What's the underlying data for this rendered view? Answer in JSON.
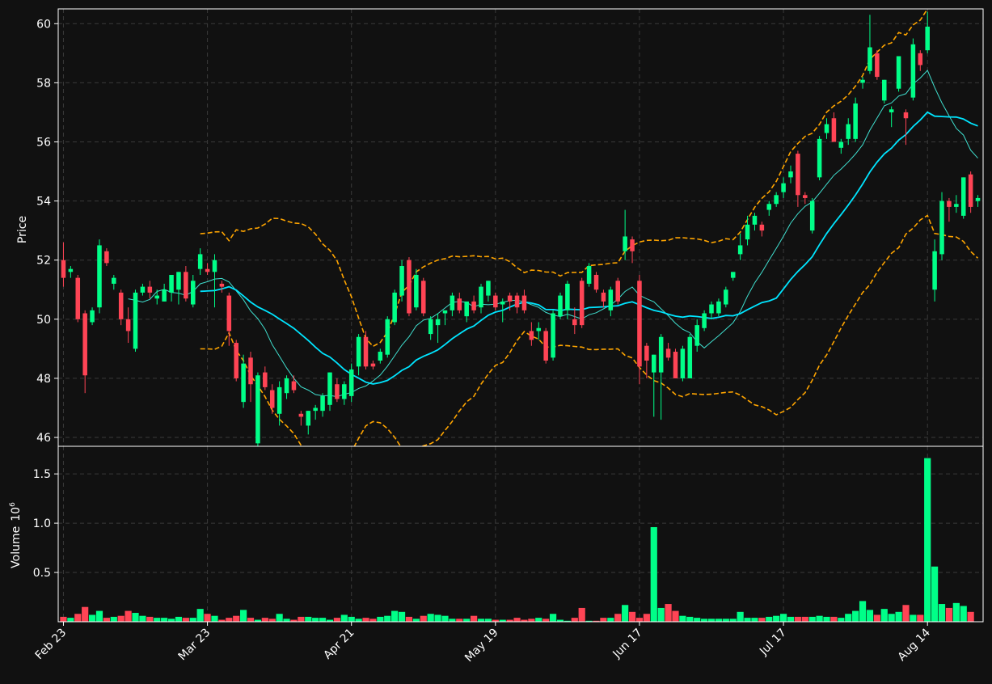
{
  "colors": {
    "background": "#111111",
    "up": "#00ff88",
    "down": "#ff4455",
    "ma_fast": "#40e0d0",
    "ma_slow": "#00e5ff",
    "bands": "#ffa500",
    "grid": "#3a3a3a",
    "axis": "#ffffff"
  },
  "chart_data": {
    "type": "candlestick",
    "price_ylabel": "Price",
    "volume_ylabel": "Volume",
    "volume_multiplier": "10",
    "volume_exponent": "6",
    "price_ylim": [
      45.7,
      60.5
    ],
    "price_ticks": [
      "46",
      "48",
      "50",
      "52",
      "54",
      "56",
      "58",
      "60"
    ],
    "price_tick_values": [
      46,
      48,
      50,
      52,
      54,
      56,
      58,
      60
    ],
    "volume_ylim": [
      0,
      1.78
    ],
    "volume_ticks": [
      "0.5",
      "1.0",
      "1.5"
    ],
    "volume_tick_values": [
      0.5,
      1.0,
      1.5
    ],
    "x_tick_labels": [
      "Feb 23",
      "Mar 23",
      "Apr 21",
      "May 19",
      "Jun 17",
      "Jul 17",
      "Aug 14"
    ],
    "x_tick_index": [
      0,
      20,
      40,
      60,
      80,
      100,
      120
    ],
    "grid": true,
    "candles": [
      [
        52.0,
        52.6,
        51.1,
        51.4
      ],
      [
        51.6,
        51.8,
        51.4,
        51.7
      ],
      [
        51.4,
        51.5,
        49.9,
        50.0
      ],
      [
        50.2,
        50.3,
        47.5,
        48.1
      ],
      [
        49.9,
        50.4,
        49.8,
        50.3
      ],
      [
        50.4,
        52.7,
        50.2,
        52.5
      ],
      [
        52.3,
        52.4,
        51.8,
        51.9
      ],
      [
        51.2,
        51.5,
        51.0,
        51.4
      ],
      [
        50.9,
        51.0,
        49.8,
        50.0
      ],
      [
        50.0,
        50.4,
        49.2,
        49.6
      ],
      [
        49.0,
        51.0,
        48.9,
        50.9
      ],
      [
        50.9,
        51.2,
        50.8,
        51.1
      ],
      [
        51.1,
        51.3,
        50.7,
        50.9
      ],
      [
        50.7,
        51.0,
        50.5,
        50.8
      ],
      [
        50.6,
        51.2,
        50.6,
        51.0
      ],
      [
        50.9,
        51.4,
        50.6,
        51.5
      ],
      [
        51.0,
        51.6,
        50.5,
        51.6
      ],
      [
        51.6,
        51.8,
        50.6,
        50.7
      ],
      [
        50.5,
        51.5,
        50.4,
        51.3
      ],
      [
        51.7,
        52.4,
        51.5,
        52.2
      ],
      [
        51.7,
        51.9,
        51.5,
        51.6
      ],
      [
        51.6,
        52.2,
        50.4,
        52.0
      ],
      [
        51.2,
        51.3,
        50.9,
        51.1
      ],
      [
        50.8,
        50.9,
        49.1,
        49.6
      ],
      [
        49.2,
        49.3,
        47.9,
        48.0
      ],
      [
        47.2,
        48.8,
        47.0,
        48.5
      ],
      [
        48.7,
        48.9,
        47.2,
        47.8
      ],
      [
        45.8,
        48.2,
        45.7,
        48.1
      ],
      [
        48.2,
        48.4,
        47.6,
        47.7
      ],
      [
        47.6,
        47.8,
        46.8,
        47.0
      ],
      [
        46.8,
        47.9,
        46.4,
        47.7
      ],
      [
        47.5,
        48.1,
        47.3,
        48.0
      ],
      [
        47.9,
        48.1,
        47.5,
        47.6
      ],
      [
        46.8,
        46.9,
        46.4,
        46.7
      ],
      [
        46.4,
        46.9,
        46.1,
        46.9
      ],
      [
        46.9,
        47.1,
        46.6,
        47.0
      ],
      [
        46.9,
        47.5,
        46.7,
        47.4
      ],
      [
        47.1,
        48.2,
        46.9,
        48.2
      ],
      [
        47.8,
        48.0,
        47.2,
        47.3
      ],
      [
        47.3,
        47.9,
        47.1,
        47.8
      ],
      [
        47.4,
        48.5,
        47.2,
        48.3
      ],
      [
        48.4,
        49.5,
        48.1,
        49.4
      ],
      [
        49.4,
        49.6,
        48.3,
        48.4
      ],
      [
        48.5,
        48.6,
        48.3,
        48.4
      ],
      [
        48.6,
        49.0,
        48.5,
        48.9
      ],
      [
        48.8,
        50.1,
        48.7,
        50.0
      ],
      [
        49.9,
        51.0,
        49.8,
        50.9
      ],
      [
        50.8,
        52.0,
        50.6,
        51.8
      ],
      [
        52.0,
        52.1,
        50.1,
        50.2
      ],
      [
        50.4,
        51.7,
        50.3,
        51.5
      ],
      [
        51.3,
        51.4,
        50.1,
        50.2
      ],
      [
        49.5,
        50.1,
        49.3,
        50.0
      ],
      [
        49.8,
        50.2,
        49.2,
        50.0
      ],
      [
        50.2,
        50.3,
        49.8,
        50.3
      ],
      [
        50.3,
        50.9,
        50.1,
        50.8
      ],
      [
        50.7,
        50.9,
        50.2,
        50.3
      ],
      [
        50.1,
        50.4,
        49.9,
        50.6
      ],
      [
        50.6,
        50.8,
        50.2,
        50.3
      ],
      [
        50.4,
        51.2,
        50.2,
        51.1
      ],
      [
        50.8,
        51.3,
        50.6,
        51.3
      ],
      [
        50.8,
        50.9,
        50.3,
        50.4
      ],
      [
        50.5,
        50.7,
        49.9,
        50.6
      ],
      [
        50.8,
        50.9,
        50.3,
        50.6
      ],
      [
        50.8,
        50.9,
        50.2,
        50.4
      ],
      [
        50.8,
        51.0,
        50.2,
        50.3
      ],
      [
        49.6,
        49.9,
        49.1,
        49.3
      ],
      [
        49.6,
        49.9,
        49.3,
        49.7
      ],
      [
        49.6,
        49.7,
        48.5,
        48.6
      ],
      [
        48.7,
        50.3,
        48.6,
        50.2
      ],
      [
        50.1,
        50.9,
        50.0,
        50.8
      ],
      [
        50.3,
        51.3,
        50.0,
        51.2
      ],
      [
        50.0,
        50.4,
        49.5,
        49.8
      ],
      [
        51.3,
        51.4,
        49.7,
        49.8
      ],
      [
        51.2,
        51.9,
        51.1,
        51.8
      ],
      [
        51.5,
        51.6,
        50.9,
        51.0
      ],
      [
        50.9,
        51.0,
        50.4,
        50.6
      ],
      [
        50.3,
        51.1,
        50.1,
        51.0
      ],
      [
        51.3,
        51.4,
        50.5,
        50.6
      ],
      [
        52.3,
        53.7,
        52.0,
        52.8
      ],
      [
        52.7,
        52.8,
        51.9,
        52.3
      ],
      [
        51.3,
        51.5,
        47.8,
        48.4
      ],
      [
        49.1,
        49.2,
        48.0,
        48.6
      ],
      [
        48.2,
        48.8,
        46.7,
        48.8
      ],
      [
        48.2,
        49.5,
        46.6,
        49.4
      ],
      [
        49.0,
        49.2,
        48.6,
        48.7
      ],
      [
        48.9,
        49.0,
        48.0,
        48.0
      ],
      [
        48.0,
        49.1,
        47.9,
        49.0
      ],
      [
        48.0,
        49.5,
        48.0,
        49.4
      ],
      [
        49.1,
        50.0,
        48.9,
        49.8
      ],
      [
        49.7,
        50.3,
        49.6,
        50.2
      ],
      [
        50.2,
        50.6,
        50.0,
        50.5
      ],
      [
        50.2,
        50.7,
        50.1,
        50.6
      ],
      [
        50.5,
        51.1,
        50.4,
        51.0
      ],
      [
        51.4,
        51.6,
        51.3,
        51.6
      ],
      [
        52.2,
        52.9,
        52.0,
        52.5
      ],
      [
        52.7,
        53.5,
        52.5,
        53.2
      ],
      [
        53.2,
        53.6,
        53.0,
        53.5
      ],
      [
        53.2,
        53.3,
        52.8,
        53.0
      ],
      [
        53.7,
        54.0,
        53.5,
        53.9
      ],
      [
        53.9,
        54.3,
        53.8,
        54.2
      ],
      [
        54.3,
        54.8,
        54.1,
        54.6
      ],
      [
        54.8,
        55.2,
        54.6,
        55.0
      ],
      [
        55.6,
        55.7,
        53.8,
        54.2
      ],
      [
        54.2,
        54.3,
        53.9,
        54.1
      ],
      [
        53.0,
        54.1,
        52.9,
        54.0
      ],
      [
        54.8,
        56.2,
        54.7,
        56.1
      ],
      [
        56.3,
        56.8,
        56.1,
        56.6
      ],
      [
        56.8,
        57.0,
        56.5,
        56.0
      ],
      [
        55.8,
        56.1,
        55.6,
        56.0
      ],
      [
        56.1,
        56.8,
        55.9,
        56.6
      ],
      [
        56.1,
        57.5,
        56.0,
        57.3
      ],
      [
        58.0,
        58.2,
        57.8,
        58.1
      ],
      [
        58.4,
        60.3,
        58.3,
        59.2
      ],
      [
        59.0,
        59.1,
        58.1,
        58.2
      ],
      [
        57.4,
        58.1,
        57.3,
        58.1
      ],
      [
        57.0,
        57.2,
        56.5,
        57.1
      ],
      [
        57.8,
        58.9,
        57.7,
        58.9
      ],
      [
        57.0,
        57.1,
        55.9,
        56.8
      ],
      [
        57.5,
        59.5,
        57.4,
        59.3
      ],
      [
        59.0,
        59.1,
        58.4,
        58.6
      ],
      [
        59.1,
        60.4,
        59.0,
        59.9
      ],
      [
        51.0,
        52.7,
        50.6,
        52.3
      ],
      [
        52.2,
        54.3,
        52.0,
        54.0
      ],
      [
        54.0,
        54.1,
        53.3,
        53.8
      ],
      [
        53.8,
        54.2,
        53.6,
        53.9
      ],
      [
        53.5,
        54.8,
        53.4,
        54.8
      ],
      [
        54.9,
        55.0,
        53.6,
        53.8
      ],
      [
        54.0,
        54.2,
        53.8,
        54.1
      ]
    ],
    "volume": [
      0.05,
      0.04,
      0.08,
      0.15,
      0.07,
      0.11,
      0.04,
      0.05,
      0.06,
      0.11,
      0.09,
      0.06,
      0.05,
      0.04,
      0.04,
      0.03,
      0.05,
      0.04,
      0.04,
      0.13,
      0.08,
      0.06,
      0.02,
      0.04,
      0.06,
      0.12,
      0.04,
      0.02,
      0.04,
      0.03,
      0.08,
      0.03,
      0.02,
      0.05,
      0.05,
      0.04,
      0.04,
      0.02,
      0.04,
      0.07,
      0.05,
      0.03,
      0.04,
      0.03,
      0.05,
      0.06,
      0.11,
      0.1,
      0.05,
      0.03,
      0.06,
      0.08,
      0.07,
      0.06,
      0.03,
      0.03,
      0.03,
      0.06,
      0.03,
      0.03,
      0.02,
      0.02,
      0.02,
      0.04,
      0.02,
      0.03,
      0.04,
      0.03,
      0.08,
      0.02,
      0.01,
      0.04,
      0.14,
      0.01,
      0.01,
      0.04,
      0.04,
      0.08,
      0.17,
      0.1,
      0.04,
      0.08,
      0.96,
      0.14,
      0.18,
      0.11,
      0.06,
      0.05,
      0.04,
      0.03,
      0.03,
      0.03,
      0.03,
      0.03,
      0.1,
      0.04,
      0.04,
      0.04,
      0.05,
      0.06,
      0.08,
      0.05,
      0.05,
      0.05,
      0.05,
      0.06,
      0.05,
      0.05,
      0.04,
      0.08,
      0.11,
      0.21,
      0.12,
      0.07,
      0.13,
      0.08,
      0.1,
      0.17,
      0.07,
      0.07,
      1.66,
      0.56,
      0.18,
      0.14,
      0.19,
      0.16,
      0.1
    ]
  }
}
